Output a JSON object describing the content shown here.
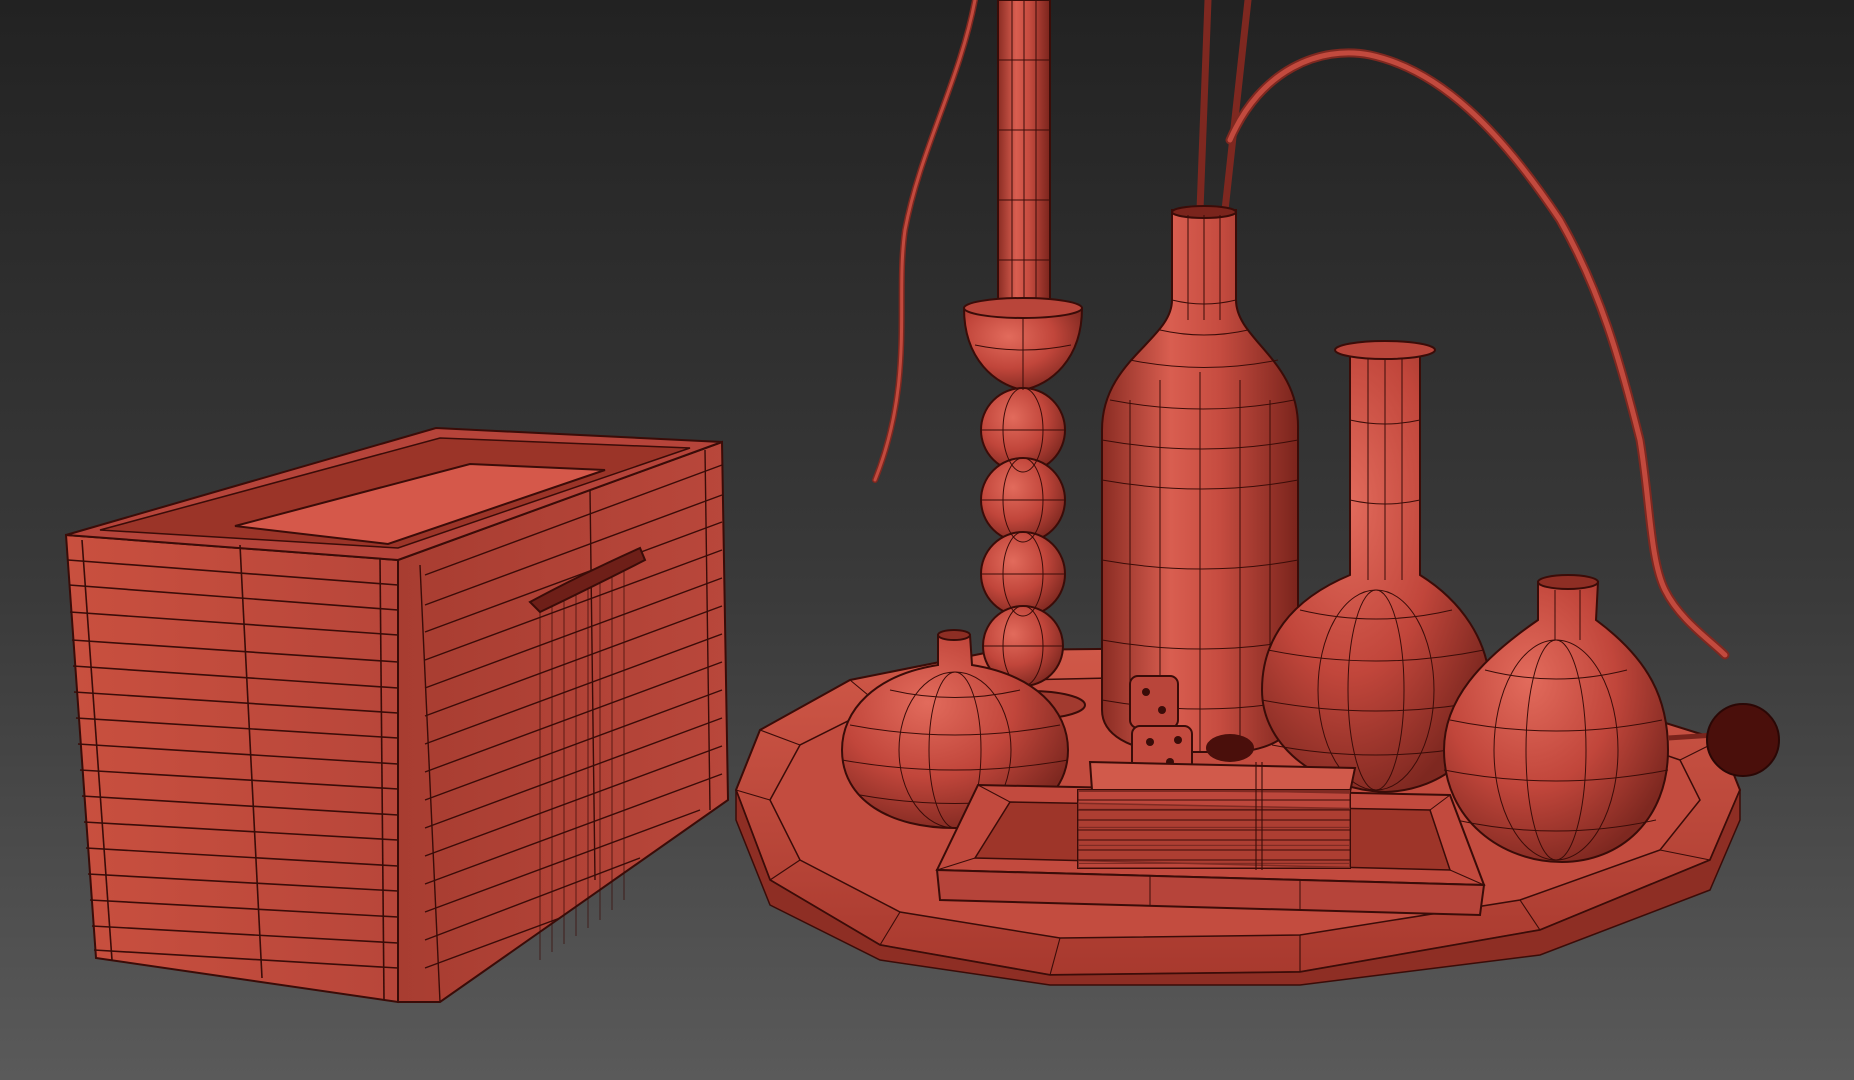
{
  "scene": {
    "kind": "3d-wireframe-render",
    "objects": [
      "wooden-storage-box",
      "round-serving-tray",
      "rectangular-dish",
      "card-deck",
      "dice-pair",
      "candle-holder",
      "candle",
      "tall-bottle",
      "long-neck-vase",
      "bud-vase",
      "round-vase",
      "dried-stems",
      "pom-ball"
    ]
  },
  "colors": {
    "background_top": "#232323",
    "background_bottom": "#585858",
    "model_base": "#c2473c",
    "model_light": "#de6658",
    "model_shadow": "#7a241c",
    "wire": "#3a0c08"
  }
}
